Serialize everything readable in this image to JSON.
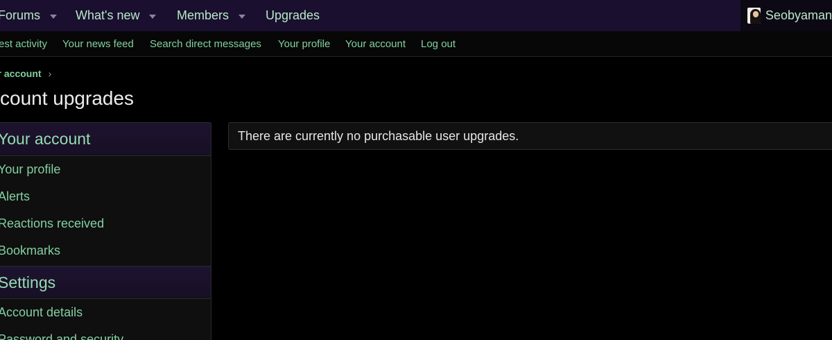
{
  "topnav": {
    "items": [
      {
        "label": "Forums",
        "has_menu": true
      },
      {
        "label": "What's new",
        "has_menu": true
      },
      {
        "label": "Members",
        "has_menu": true
      },
      {
        "label": "Upgrades",
        "has_menu": false
      }
    ],
    "user": {
      "name": "Seobyaman",
      "avatar_icon": "user-avatar"
    }
  },
  "subnav": {
    "items": [
      "est activity",
      "Your news feed",
      "Search direct messages",
      "Your profile",
      "Your account",
      "Log out"
    ]
  },
  "breadcrumb": {
    "label": "ur account",
    "separator": "›"
  },
  "page": {
    "title": "ccount upgrades"
  },
  "sidebar": {
    "groups": [
      {
        "heading": "Your account",
        "items": [
          "Your profile",
          "Alerts",
          "Reactions received",
          "Bookmarks"
        ]
      },
      {
        "heading": "Settings",
        "items": [
          "Account details",
          "Password and security"
        ]
      }
    ]
  },
  "main": {
    "notice": "There are currently no purchasable user upgrades."
  },
  "colors": {
    "nav_bg": "#1a0f2e",
    "link": "#82d0a0",
    "background": "#000000"
  }
}
